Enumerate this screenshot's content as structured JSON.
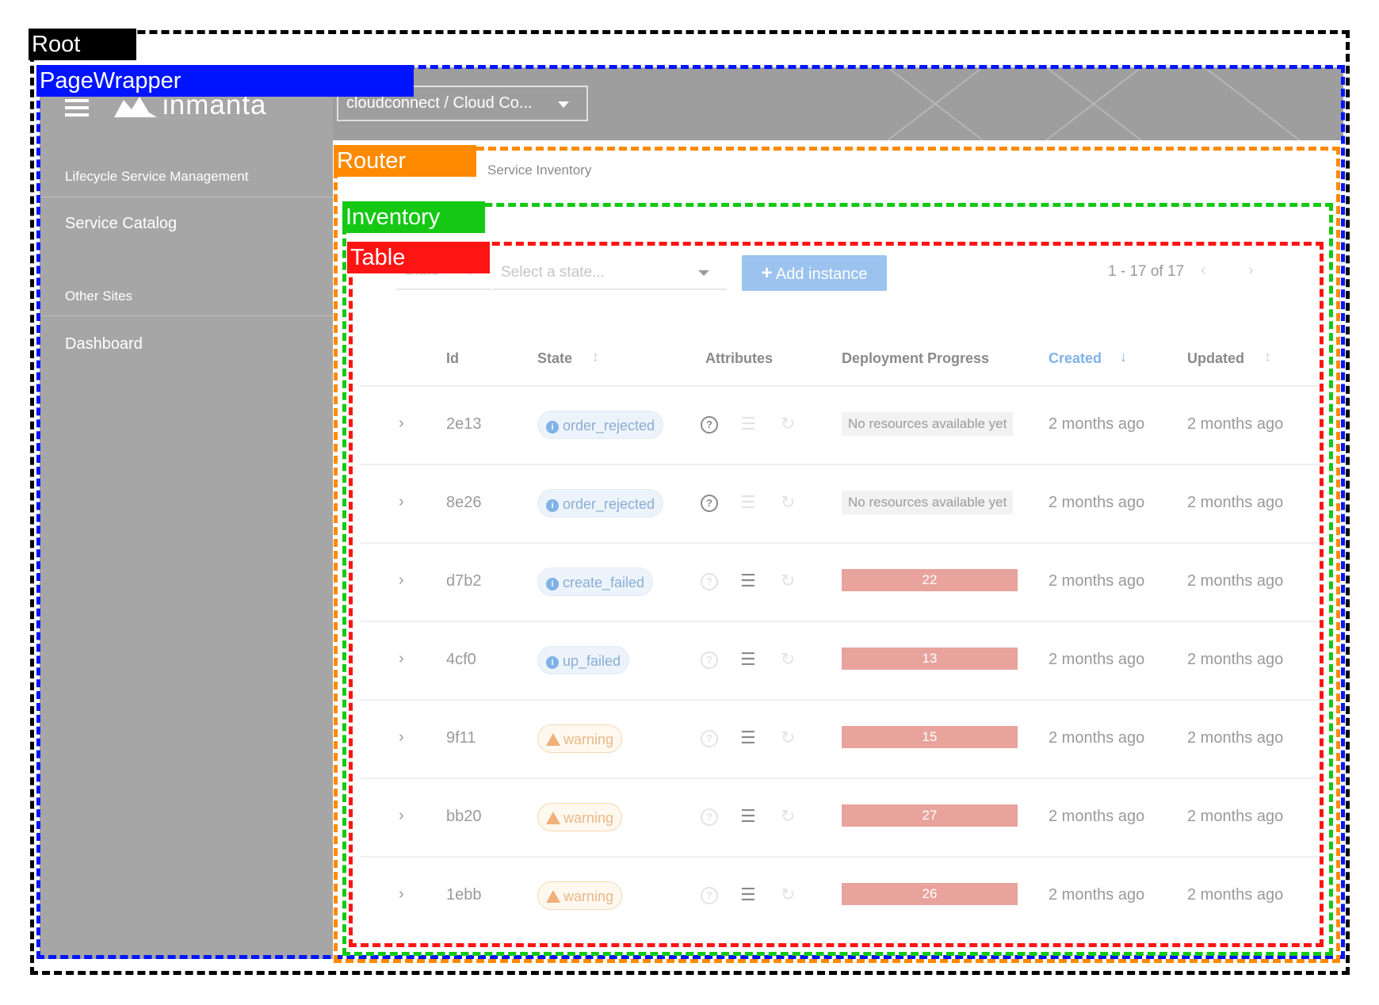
{
  "labels": {
    "root": "Root",
    "page_wrapper": "PageWrapper",
    "router": "Router",
    "inventory": "Inventory",
    "table": "Table"
  },
  "header": {
    "logo_text": "inmanta",
    "environment": "cloudconnect / Cloud Co..."
  },
  "sidebar": {
    "section1": "Lifecycle Service Management",
    "item1": "Service Catalog",
    "section2": "Other Sites",
    "item2": "Dashboard"
  },
  "breadcrumb": {
    "current": "Service Inventory"
  },
  "toolbar": {
    "filter_label": "State",
    "state_placeholder": "Select a state...",
    "add_button": "Add instance",
    "pagination": "1 - 17 of 17"
  },
  "columns": [
    "Id",
    "State",
    "Attributes",
    "Deployment Progress",
    "Created",
    "Updated"
  ],
  "rows": [
    {
      "id": "2e13",
      "state": "order_rejected",
      "state_type": "info",
      "progress": "No resources available yet",
      "progress_bar": null,
      "created": "2 months ago",
      "updated": "2 months ago"
    },
    {
      "id": "8e26",
      "state": "order_rejected",
      "state_type": "info",
      "progress": "No resources available yet",
      "progress_bar": null,
      "created": "2 months ago",
      "updated": "2 months ago"
    },
    {
      "id": "d7b2",
      "state": "create_failed",
      "state_type": "info",
      "progress": "22",
      "progress_bar": 1.0,
      "created": "2 months ago",
      "updated": "2 months ago"
    },
    {
      "id": "4cf0",
      "state": "up_failed",
      "state_type": "info",
      "progress": "13",
      "progress_bar": 1.0,
      "created": "2 months ago",
      "updated": "2 months ago"
    },
    {
      "id": "9f11",
      "state": "warning",
      "state_type": "warning",
      "progress": "15",
      "progress_bar": 1.0,
      "created": "2 months ago",
      "updated": "2 months ago"
    },
    {
      "id": "bb20",
      "state": "warning",
      "state_type": "warning",
      "progress": "27",
      "progress_bar": 1.0,
      "created": "2 months ago",
      "updated": "2 months ago"
    },
    {
      "id": "1ebb",
      "state": "warning",
      "state_type": "warning",
      "progress": "26",
      "progress_bar": 1.0,
      "created": "2 months ago",
      "updated": "2 months ago"
    }
  ],
  "colors": {
    "root": "#000000",
    "page_wrapper": "#0014ff",
    "router": "#ff8a00",
    "inventory": "#14c814",
    "table": "#ff1414",
    "add_button": "#9cc3ee",
    "progress_bar": "#e8a39d"
  }
}
